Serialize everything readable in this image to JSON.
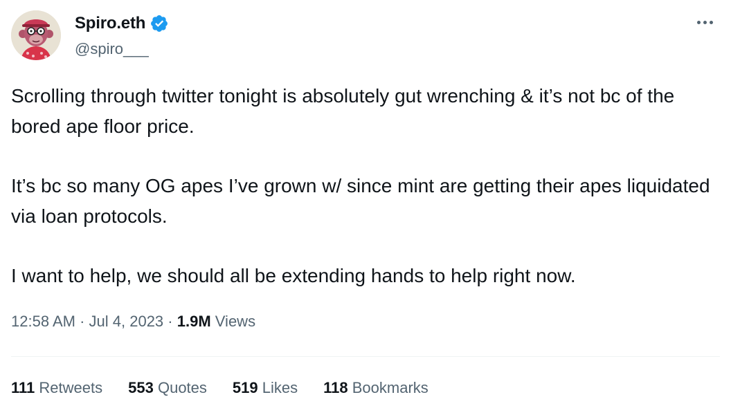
{
  "author": {
    "display_name": "Spiro.eth",
    "handle": "@spiro___",
    "verified": true,
    "avatar_icon": "bored-ape-avatar"
  },
  "tweet": {
    "paragraphs": [
      "Scrolling through twitter tonight is absolutely gut wrenching & it’s not bc of the bored ape floor price.",
      "It’s bc so many OG apes I’ve grown w/ since mint are getting their apes liquidated via loan protocols.",
      "I want to help, we should all be extending hands to help right now."
    ],
    "time": "12:58 AM",
    "separator": "·",
    "date": "Jul 4, 2023",
    "views_count": "1.9M",
    "views_label": "Views"
  },
  "stats": [
    {
      "count": "111",
      "label": "Retweets"
    },
    {
      "count": "553",
      "label": "Quotes"
    },
    {
      "count": "519",
      "label": "Likes"
    },
    {
      "count": "118",
      "label": "Bookmarks"
    }
  ],
  "colors": {
    "text_primary": "#0f1419",
    "text_secondary": "#536471",
    "verified_blue": "#1d9bf0",
    "divider": "#eff3f4"
  },
  "icons": {
    "more": "more-horizontal-icon",
    "verified": "verified-badge-icon"
  }
}
